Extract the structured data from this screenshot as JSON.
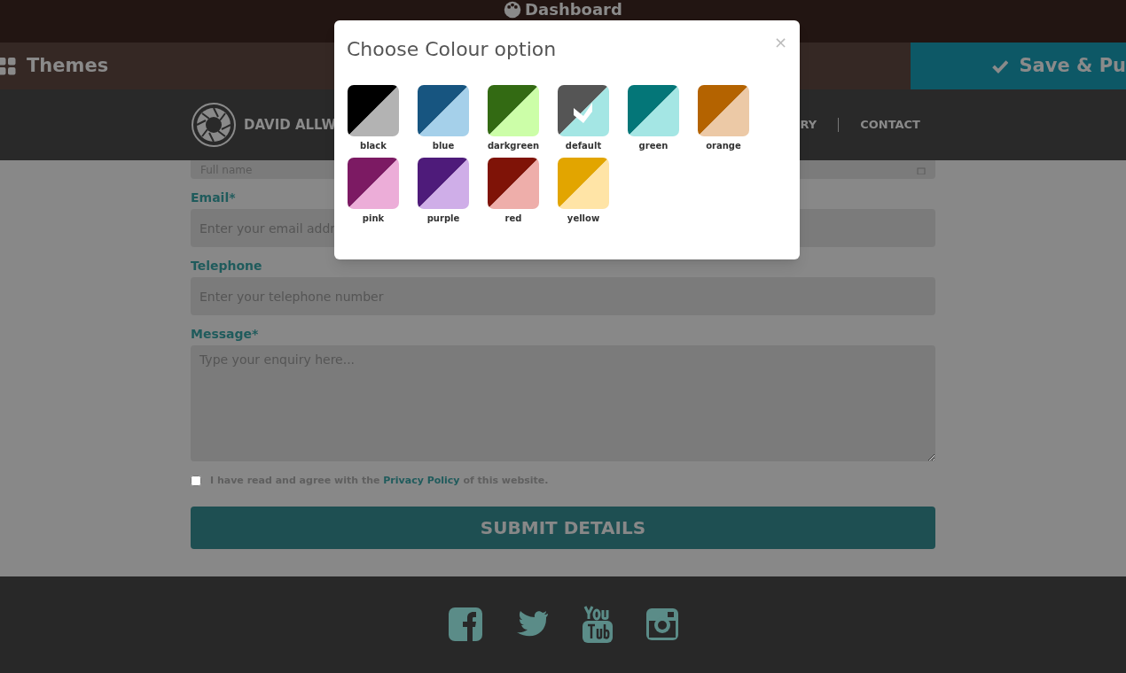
{
  "top_bar": {
    "title": "Dashboard"
  },
  "toolbar": {
    "themes_label": "Themes",
    "save_label": "Save & Pu"
  },
  "site_nav": {
    "brand": "DAVID ALLW",
    "links": [
      "RY",
      "CONTACT"
    ]
  },
  "form": {
    "full_name": {
      "placeholder": "Full name"
    },
    "fields": [
      {
        "kind": "input",
        "label": "Email*",
        "placeholder": "Enter your email addr"
      },
      {
        "kind": "input",
        "label": "Telephone",
        "placeholder": "Enter your telephone number"
      },
      {
        "kind": "textarea",
        "label": "Message*",
        "placeholder": "Type your enquiry here..."
      }
    ],
    "agree": {
      "checked": false,
      "before": "I have read and agree with the",
      "link": "Privacy Policy",
      "after": "of this website."
    },
    "submit": "SUBMIT DETAILS"
  },
  "modal": {
    "title": "Choose Colour option",
    "close": "×",
    "swatches": [
      {
        "name": "black",
        "halves": [
          {
            "color": "#000000"
          },
          {
            "color": "#b3b3b3"
          }
        ],
        "selected": false
      },
      {
        "name": "blue",
        "halves": [
          {
            "color": "#175580"
          },
          {
            "color": "#a5d0ea"
          }
        ],
        "selected": false
      },
      {
        "name": "darkgreen",
        "halves": [
          {
            "color": "#336a13"
          },
          {
            "color": "#ccfea8"
          }
        ],
        "selected": false
      },
      {
        "name": "default",
        "halves": [
          {
            "color": "#555555"
          },
          {
            "color": "#a4e6e4"
          }
        ],
        "selected": true
      },
      {
        "name": "green",
        "halves": [
          {
            "color": "#047678"
          },
          {
            "color": "#a4e6e4"
          }
        ],
        "selected": false
      },
      {
        "name": "orange",
        "halves": [
          {
            "color": "#b46300"
          },
          {
            "color": "#ecc9a6"
          }
        ],
        "selected": false
      },
      {
        "name": "pink",
        "halves": [
          {
            "color": "#7c1a63"
          },
          {
            "color": "#ecadd8"
          }
        ],
        "selected": false
      },
      {
        "name": "purple",
        "halves": [
          {
            "color": "#4e1b7a"
          },
          {
            "color": "#cfaee8"
          }
        ],
        "selected": false
      },
      {
        "name": "red",
        "halves": [
          {
            "color": "#7f1307"
          },
          {
            "color": "#eeaeaa"
          }
        ],
        "selected": false
      },
      {
        "name": "yellow",
        "halves": [
          {
            "color": "#e2a500"
          },
          {
            "color": "#ffe4a6"
          }
        ],
        "selected": false
      }
    ]
  }
}
